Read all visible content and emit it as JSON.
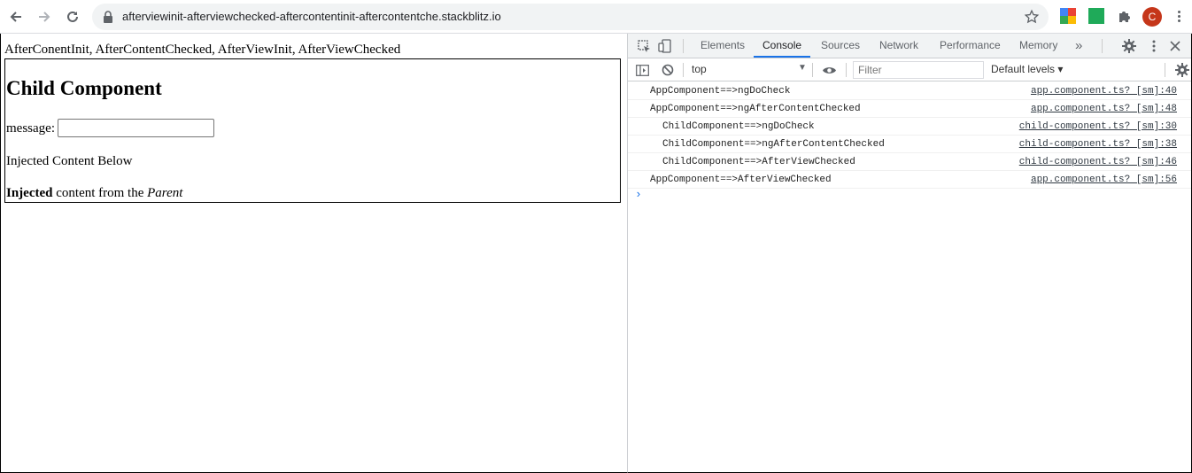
{
  "browser": {
    "url": "afterviewinit-afterviewchecked-aftercontentinit-aftercontentche.stackblitz.io",
    "avatar_letter": "C",
    "accent_color": "#1a73e8"
  },
  "page": {
    "hooks_text": "AfterConentInit, AfterContentChecked, AfterViewInit, AfterViewChecked",
    "child_heading": "Child Component",
    "message_label": "message:",
    "message_value": "",
    "injected_below": "Injected Content Below",
    "injected_bold": "Injected",
    "injected_mid": " content from the ",
    "injected_italic": "Parent"
  },
  "devtools": {
    "tabs": [
      "Elements",
      "Console",
      "Sources",
      "Network",
      "Performance",
      "Memory"
    ],
    "active_tab": "Console",
    "more_tabs_glyph": "»",
    "context": "top",
    "filter_placeholder": "Filter",
    "levels": "Default levels ▾",
    "logs": [
      {
        "msg": "AppComponent==>ngDoCheck",
        "src": "app.component.ts? [sm]:40"
      },
      {
        "msg": "AppComponent==>ngAfterContentChecked",
        "src": "app.component.ts? [sm]:48"
      },
      {
        "msg": "ChildComponent==>ngDoCheck",
        "src": "child-component.ts? [sm]:30"
      },
      {
        "msg": "ChildComponent==>ngAfterContentChecked",
        "src": "child-component.ts? [sm]:38"
      },
      {
        "msg": "ChildComponent==>AfterViewChecked",
        "src": "child-component.ts? [sm]:46"
      },
      {
        "msg": "AppComponent==>AfterViewChecked",
        "src": "app.component.ts? [sm]:56"
      }
    ],
    "prompt_glyph": "›"
  }
}
